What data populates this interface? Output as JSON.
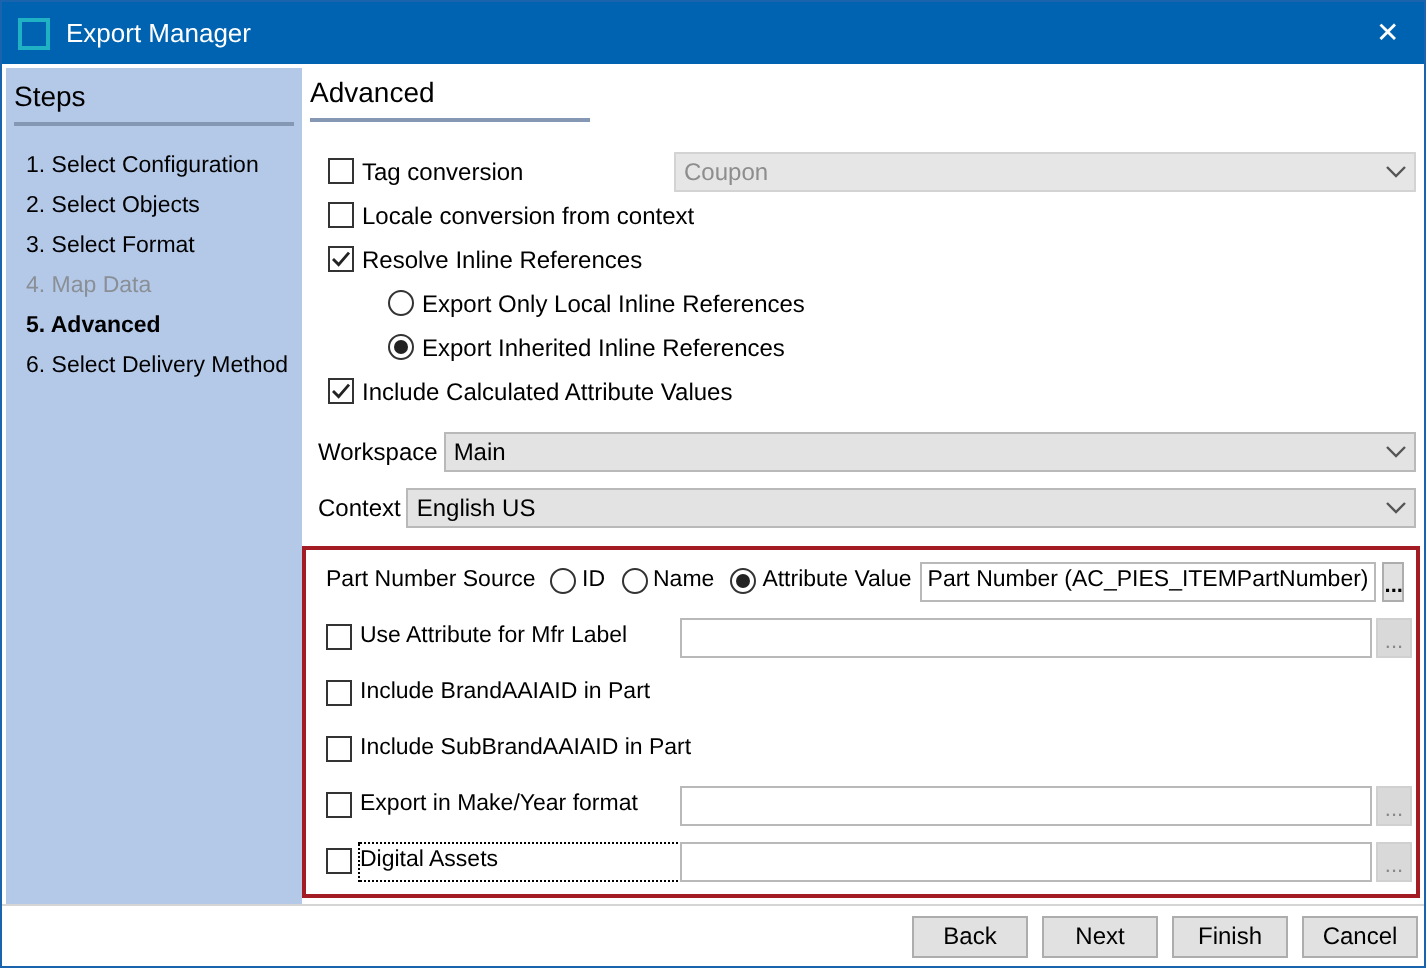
{
  "window": {
    "title": "Export Manager",
    "close": "✕"
  },
  "steps": {
    "title": "Steps",
    "items": [
      {
        "label": "1. Select Configuration",
        "selected": false,
        "disabled": false
      },
      {
        "label": "2. Select Objects",
        "selected": false,
        "disabled": false
      },
      {
        "label": "3. Select Format",
        "selected": false,
        "disabled": false
      },
      {
        "label": "4. Map Data",
        "selected": false,
        "disabled": true
      },
      {
        "label": "5. Advanced",
        "selected": true,
        "disabled": false
      },
      {
        "label": "6. Select Delivery Method",
        "selected": false,
        "disabled": false
      }
    ]
  },
  "section_title": "Advanced",
  "options": [
    {
      "kind": "checkbox",
      "label": "Tag conversion",
      "checked": false,
      "dropdown": {
        "value": "Coupon",
        "disabled": true
      }
    },
    {
      "kind": "checkbox",
      "label": "Locale conversion from context",
      "checked": false
    },
    {
      "kind": "checkbox",
      "label": "Resolve Inline References",
      "checked": true
    },
    {
      "kind": "radio",
      "label": "Export Only Local Inline References",
      "selected": false
    },
    {
      "kind": "radio",
      "label": "Export Inherited Inline References",
      "selected": true
    },
    {
      "kind": "checkbox",
      "label": "Include Calculated Attribute Values",
      "checked": true
    }
  ],
  "fields": [
    {
      "label": "Workspace",
      "value": "Main"
    },
    {
      "label": "Context",
      "value": "English US"
    }
  ],
  "part_number": {
    "label": "Part Number Source",
    "choices": [
      {
        "label": "ID",
        "selected": false
      },
      {
        "label": "Name",
        "selected": false
      },
      {
        "label": "Attribute Value",
        "selected": true
      }
    ],
    "value": "Part Number (AC_PIES_ITEMPartNumber)",
    "browse": "..."
  },
  "pies_options": [
    {
      "kind": "field",
      "label": "Use Attribute for Mfr Label",
      "checked": false,
      "focused": false,
      "browse": "..."
    },
    {
      "kind": "plain",
      "label": "Include BrandAAIAID in Part",
      "checked": false,
      "focused": false
    },
    {
      "kind": "plain",
      "label": "Include SubBrandAAIAID in Part",
      "checked": false,
      "focused": false
    },
    {
      "kind": "field",
      "label": "Export in Make/Year format",
      "checked": false,
      "focused": false,
      "browse": "..."
    },
    {
      "kind": "field",
      "label": "Digital Assets",
      "checked": false,
      "focused": true,
      "browse": "..."
    }
  ],
  "buttons": [
    "Back",
    "Next",
    "Finish",
    "Cancel"
  ]
}
